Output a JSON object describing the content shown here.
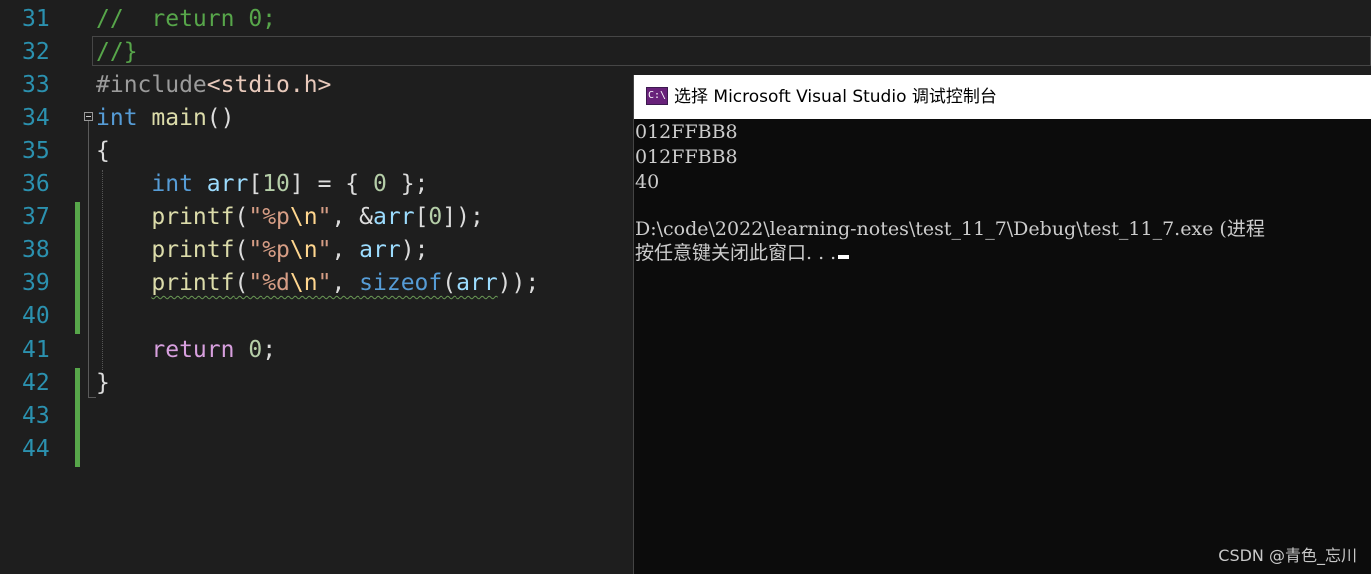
{
  "editor": {
    "line_numbers": [
      "31",
      "32",
      "33",
      "34",
      "35",
      "36",
      "37",
      "38",
      "39",
      "40",
      "41",
      "42",
      "43",
      "44"
    ],
    "lines": {
      "l31": {
        "comment": "//  return 0;"
      },
      "l32": {
        "comment": "//}"
      },
      "l33": {
        "directive": "#include",
        "header": "<stdio.h>"
      },
      "l34": {
        "type": "int",
        "name": "main",
        "parens": "()"
      },
      "l35": {
        "text": "{"
      },
      "l36": {
        "type": "int",
        "var": "arr",
        "open": "[",
        "size": "10",
        "rest": "] = { ",
        "zero": "0",
        "end": " };"
      },
      "l37": {
        "fn": "printf",
        "open": "(",
        "q1": "\"",
        "fmt": "%p",
        "esc": "\\n",
        "q2": "\"",
        "mid": ", &",
        "var": "arr",
        "idx_open": "[",
        "idx": "0",
        "close": "]);"
      },
      "l38": {
        "fn": "printf",
        "open": "(",
        "q1": "\"",
        "fmt": "%p",
        "esc": "\\n",
        "q2": "\"",
        "mid": ", ",
        "var": "arr",
        "close": ");"
      },
      "l39": {
        "fn": "printf",
        "open": "(",
        "q1": "\"",
        "fmt": "%d",
        "esc": "\\n",
        "q2": "\"",
        "mid": ", ",
        "kw": "sizeof",
        "p1": "(",
        "var": "arr",
        "close": "));"
      },
      "l41": {
        "kw": "return",
        "sp": " ",
        "zero": "0",
        "end": ";"
      },
      "l42": {
        "text": "}"
      }
    }
  },
  "console": {
    "title": "选择 Microsoft Visual Studio 调试控制台",
    "icon_label": "C:\\",
    "output": [
      "012FFBB8",
      "012FFBB8",
      "40",
      "",
      "D:\\code\\2022\\learning-notes\\test_11_7\\Debug\\test_11_7.exe (进程",
      "按任意键关闭此窗口. . ."
    ]
  },
  "watermark": "CSDN @青色_忘川",
  "colors": {
    "background": "#1e1e1e",
    "line_number": "#2b91af",
    "comment": "#57a64a",
    "keyword": "#569cd6",
    "console_bg": "#0c0c0c"
  }
}
